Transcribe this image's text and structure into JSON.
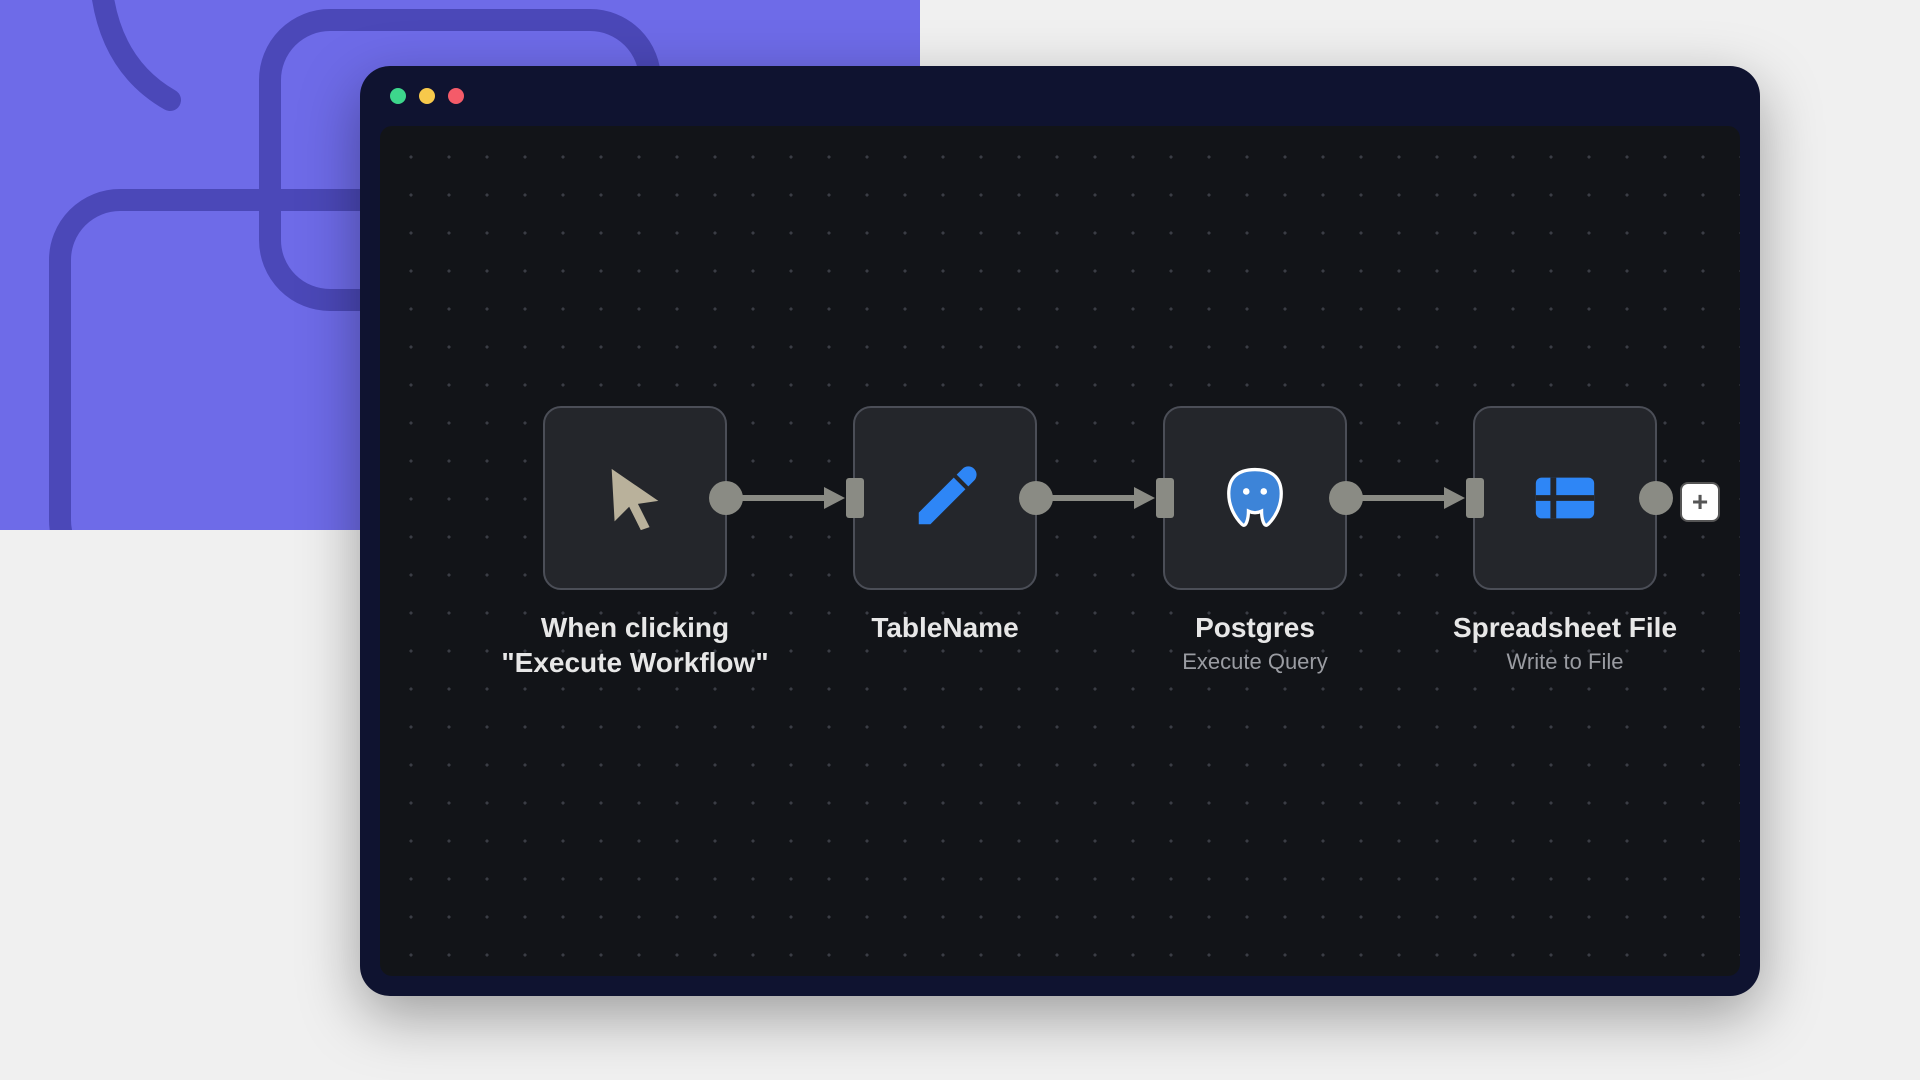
{
  "background": {
    "decor_color": "#6E6BE8"
  },
  "window": {
    "traffic_lights": [
      "close",
      "minimize",
      "zoom"
    ]
  },
  "workflow": {
    "nodes": [
      {
        "icon": "cursor-icon",
        "title": "When clicking \"Execute Workflow\"",
        "subtitle": ""
      },
      {
        "icon": "pencil-icon",
        "title": "TableName",
        "subtitle": ""
      },
      {
        "icon": "postgres-icon",
        "title": "Postgres",
        "subtitle": "Execute Query"
      },
      {
        "icon": "spreadsheet-icon",
        "title": "Spreadsheet File",
        "subtitle": "Write to File"
      }
    ],
    "add_button_label": "+"
  }
}
